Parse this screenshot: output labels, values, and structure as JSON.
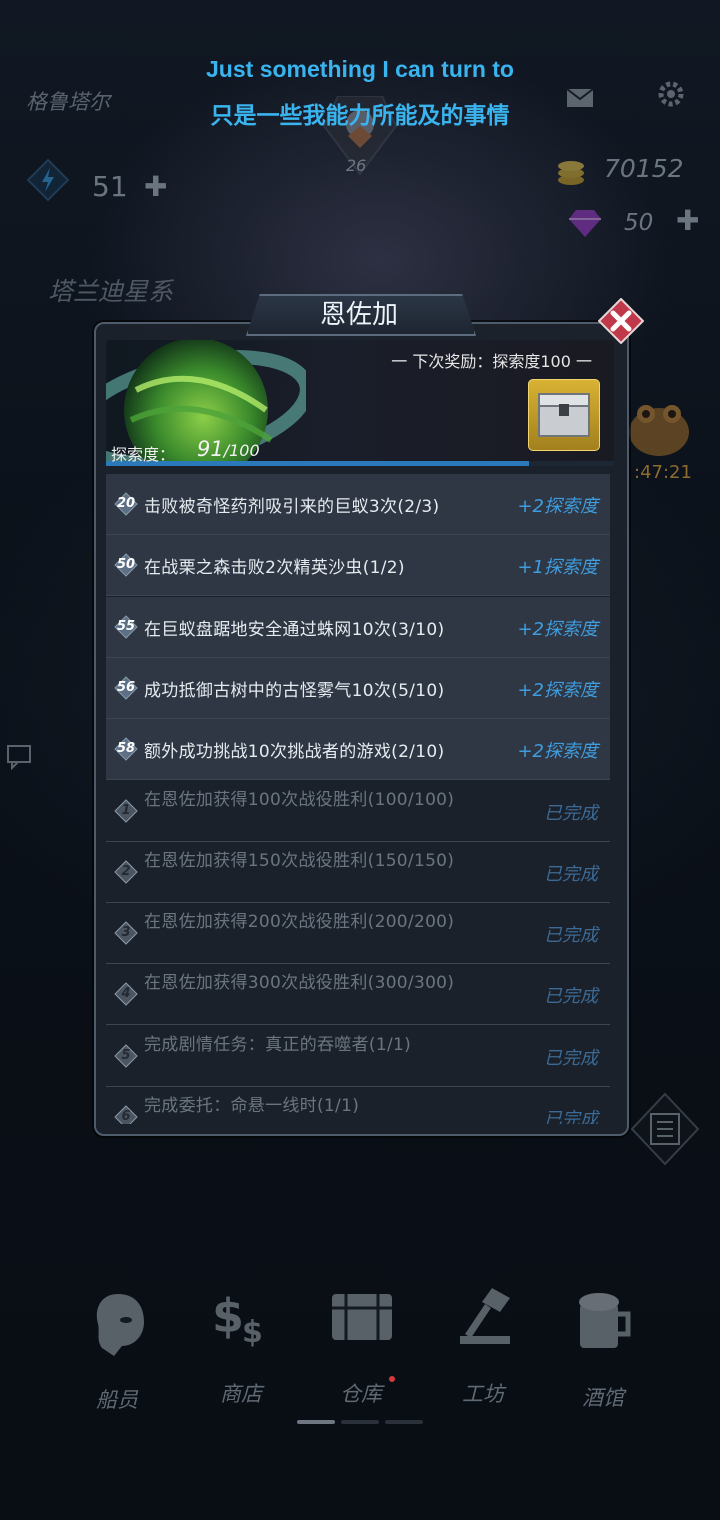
{
  "subtitles": {
    "english": "Just something I can turn to",
    "chinese": "只是一些我能力所能及的事情"
  },
  "hud": {
    "player_name": "格鲁塔尔",
    "level": "26",
    "energy": "51",
    "coins": "70152",
    "gems": "50",
    "star_system": "塔兰迪星系",
    "timer": ":47:21"
  },
  "modal": {
    "title": "恩佐加",
    "next_reward_label": "一 下次奖励：探索度100 一",
    "exploration_label": "探索度：",
    "exploration_value": "91",
    "exploration_max": "/100",
    "exploration_progress": 0.91,
    "tasks": [
      {
        "num": "20",
        "text": "击败被奇怪药剂吸引来的巨蚁3次(2/3)",
        "reward": "+2探索度",
        "done": false
      },
      {
        "num": "50",
        "text": "在战栗之森击败2次精英沙虫(1/2)",
        "reward": "+1探索度",
        "done": false
      },
      {
        "num": "55",
        "text": "在巨蚁盘踞地安全通过蛛网10次(3/10)",
        "reward": "+2探索度",
        "done": false
      },
      {
        "num": "56",
        "text": "成功抵御古树中的古怪雾气10次(5/10)",
        "reward": "+2探索度",
        "done": false
      },
      {
        "num": "58",
        "text": "额外成功挑战10次挑战者的游戏(2/10)",
        "reward": "+2探索度",
        "done": false
      },
      {
        "num": "1",
        "text": "在恩佐加获得100次战役胜利(100/100)",
        "reward": "已完成",
        "done": true
      },
      {
        "num": "2",
        "text": "在恩佐加获得150次战役胜利(150/150)",
        "reward": "已完成",
        "done": true
      },
      {
        "num": "3",
        "text": "在恩佐加获得200次战役胜利(200/200)",
        "reward": "已完成",
        "done": true
      },
      {
        "num": "4",
        "text": "在恩佐加获得300次战役胜利(300/300)",
        "reward": "已完成",
        "done": true
      },
      {
        "num": "5",
        "text": "完成剧情任务：真正的吞噬者(1/1)",
        "reward": "已完成",
        "done": true
      },
      {
        "num": "6",
        "text": "完成委托：命悬一线时(1/1)",
        "reward": "已完成",
        "done": true
      }
    ]
  },
  "bottom_nav": [
    {
      "label": "船员",
      "icon": "crew-icon"
    },
    {
      "label": "商店",
      "icon": "shop-icon"
    },
    {
      "label": "仓库",
      "icon": "warehouse-icon",
      "badge": true
    },
    {
      "label": "工坊",
      "icon": "workshop-icon"
    },
    {
      "label": "酒馆",
      "icon": "tavern-icon"
    }
  ],
  "colors": {
    "accent_blue": "#3f9cde",
    "subtitle_blue": "#3ab4ef",
    "close_red": "#c0394a",
    "coin_gold": "#c9a227",
    "gem_purple": "#9a39c9"
  }
}
